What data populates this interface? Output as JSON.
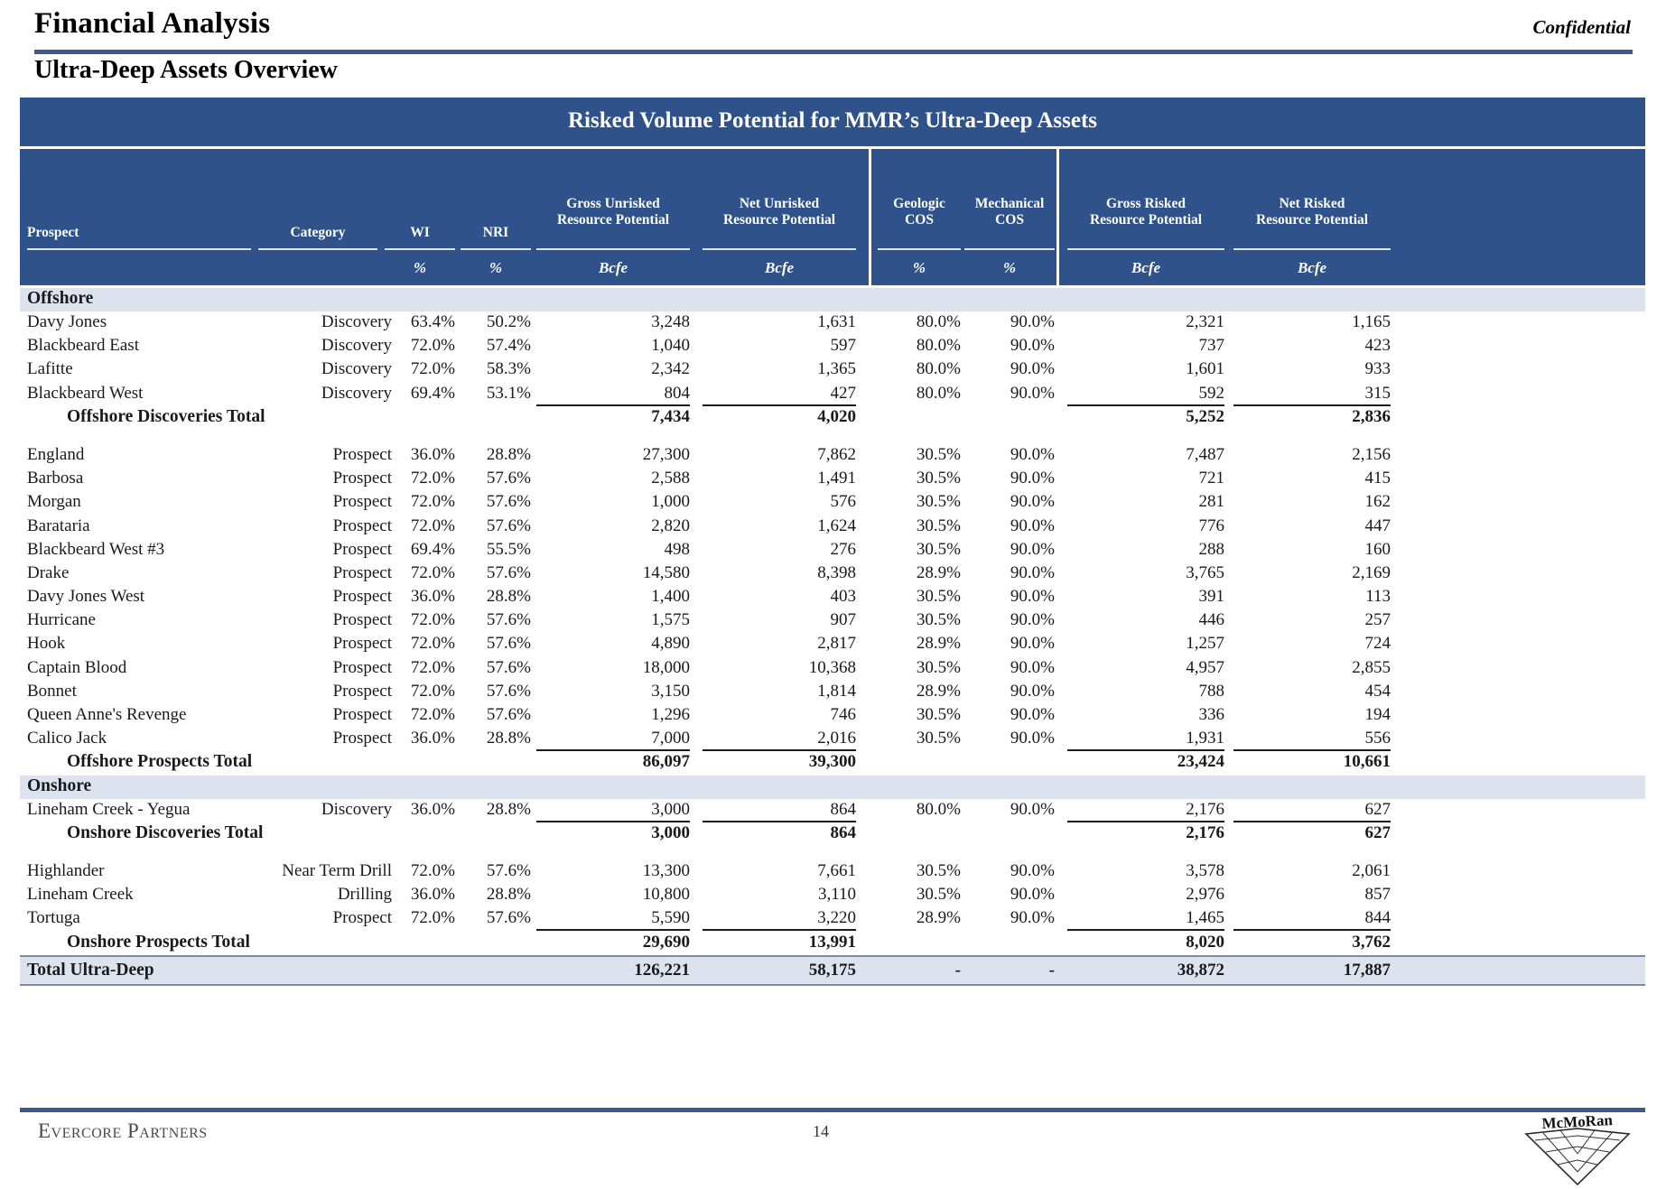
{
  "header": {
    "doc_title": "Financial Analysis",
    "confidential": "Confidential",
    "section_title": "Ultra-Deep Assets Overview"
  },
  "table": {
    "banner": "Risked Volume Potential for MMR’s Ultra-Deep Assets",
    "columns": [
      {
        "l1": "",
        "l2": "Prospect",
        "unit": ""
      },
      {
        "l1": "",
        "l2": "Category",
        "unit": ""
      },
      {
        "l1": "",
        "l2": "WI",
        "unit": "%"
      },
      {
        "l1": "",
        "l2": "NRI",
        "unit": "%"
      },
      {
        "l1": "Gross Unrisked",
        "l2": "Resource Potential",
        "unit": "Bcfe"
      },
      {
        "l1": "Net Unrisked",
        "l2": "Resource Potential",
        "unit": "Bcfe"
      },
      {
        "l1": "Geologic",
        "l2": "COS",
        "unit": "%"
      },
      {
        "l1": "Mechanical",
        "l2": "COS",
        "unit": "%"
      },
      {
        "l1": "Gross Risked",
        "l2": "Resource Potential",
        "unit": "Bcfe"
      },
      {
        "l1": "Net Risked",
        "l2": "Resource Potential",
        "unit": "Bcfe"
      }
    ],
    "groups": [
      {
        "label": "Offshore",
        "blocks": [
          {
            "rows": [
              {
                "prospect": "Davy Jones",
                "category": "Discovery",
                "wi": "63.4%",
                "nri": "50.2%",
                "gross_unrisked": "3,248",
                "net_unrisked": "1,631",
                "geologic_cos": "80.0%",
                "mechanical_cos": "90.0%",
                "gross_risked": "2,321",
                "net_risked": "1,165"
              },
              {
                "prospect": "Blackbeard East",
                "category": "Discovery",
                "wi": "72.0%",
                "nri": "57.4%",
                "gross_unrisked": "1,040",
                "net_unrisked": "597",
                "geologic_cos": "80.0%",
                "mechanical_cos": "90.0%",
                "gross_risked": "737",
                "net_risked": "423"
              },
              {
                "prospect": "Lafitte",
                "category": "Discovery",
                "wi": "72.0%",
                "nri": "58.3%",
                "gross_unrisked": "2,342",
                "net_unrisked": "1,365",
                "geologic_cos": "80.0%",
                "mechanical_cos": "90.0%",
                "gross_risked": "1,601",
                "net_risked": "933"
              },
              {
                "prospect": "Blackbeard West",
                "category": "Discovery",
                "wi": "69.4%",
                "nri": "53.1%",
                "gross_unrisked": "804",
                "net_unrisked": "427",
                "geologic_cos": "80.0%",
                "mechanical_cos": "90.0%",
                "gross_risked": "592",
                "net_risked": "315"
              }
            ],
            "total": {
              "label": "Offshore Discoveries Total",
              "gross_unrisked": "7,434",
              "net_unrisked": "4,020",
              "gross_risked": "5,252",
              "net_risked": "2,836"
            }
          },
          {
            "rows": [
              {
                "prospect": "England",
                "category": "Prospect",
                "wi": "36.0%",
                "nri": "28.8%",
                "gross_unrisked": "27,300",
                "net_unrisked": "7,862",
                "geologic_cos": "30.5%",
                "mechanical_cos": "90.0%",
                "gross_risked": "7,487",
                "net_risked": "2,156"
              },
              {
                "prospect": "Barbosa",
                "category": "Prospect",
                "wi": "72.0%",
                "nri": "57.6%",
                "gross_unrisked": "2,588",
                "net_unrisked": "1,491",
                "geologic_cos": "30.5%",
                "mechanical_cos": "90.0%",
                "gross_risked": "721",
                "net_risked": "415"
              },
              {
                "prospect": "Morgan",
                "category": "Prospect",
                "wi": "72.0%",
                "nri": "57.6%",
                "gross_unrisked": "1,000",
                "net_unrisked": "576",
                "geologic_cos": "30.5%",
                "mechanical_cos": "90.0%",
                "gross_risked": "281",
                "net_risked": "162"
              },
              {
                "prospect": "Barataria",
                "category": "Prospect",
                "wi": "72.0%",
                "nri": "57.6%",
                "gross_unrisked": "2,820",
                "net_unrisked": "1,624",
                "geologic_cos": "30.5%",
                "mechanical_cos": "90.0%",
                "gross_risked": "776",
                "net_risked": "447"
              },
              {
                "prospect": "Blackbeard West #3",
                "category": "Prospect",
                "wi": "69.4%",
                "nri": "55.5%",
                "gross_unrisked": "498",
                "net_unrisked": "276",
                "geologic_cos": "30.5%",
                "mechanical_cos": "90.0%",
                "gross_risked": "288",
                "net_risked": "160"
              },
              {
                "prospect": "Drake",
                "category": "Prospect",
                "wi": "72.0%",
                "nri": "57.6%",
                "gross_unrisked": "14,580",
                "net_unrisked": "8,398",
                "geologic_cos": "28.9%",
                "mechanical_cos": "90.0%",
                "gross_risked": "3,765",
                "net_risked": "2,169"
              },
              {
                "prospect": "Davy Jones West",
                "category": "Prospect",
                "wi": "36.0%",
                "nri": "28.8%",
                "gross_unrisked": "1,400",
                "net_unrisked": "403",
                "geologic_cos": "30.5%",
                "mechanical_cos": "90.0%",
                "gross_risked": "391",
                "net_risked": "113"
              },
              {
                "prospect": "Hurricane",
                "category": "Prospect",
                "wi": "72.0%",
                "nri": "57.6%",
                "gross_unrisked": "1,575",
                "net_unrisked": "907",
                "geologic_cos": "30.5%",
                "mechanical_cos": "90.0%",
                "gross_risked": "446",
                "net_risked": "257"
              },
              {
                "prospect": "Hook",
                "category": "Prospect",
                "wi": "72.0%",
                "nri": "57.6%",
                "gross_unrisked": "4,890",
                "net_unrisked": "2,817",
                "geologic_cos": "28.9%",
                "mechanical_cos": "90.0%",
                "gross_risked": "1,257",
                "net_risked": "724"
              },
              {
                "prospect": "Captain Blood",
                "category": "Prospect",
                "wi": "72.0%",
                "nri": "57.6%",
                "gross_unrisked": "18,000",
                "net_unrisked": "10,368",
                "geologic_cos": "30.5%",
                "mechanical_cos": "90.0%",
                "gross_risked": "4,957",
                "net_risked": "2,855"
              },
              {
                "prospect": "Bonnet",
                "category": "Prospect",
                "wi": "72.0%",
                "nri": "57.6%",
                "gross_unrisked": "3,150",
                "net_unrisked": "1,814",
                "geologic_cos": "28.9%",
                "mechanical_cos": "90.0%",
                "gross_risked": "788",
                "net_risked": "454"
              },
              {
                "prospect": "Queen Anne's Revenge",
                "category": "Prospect",
                "wi": "72.0%",
                "nri": "57.6%",
                "gross_unrisked": "1,296",
                "net_unrisked": "746",
                "geologic_cos": "30.5%",
                "mechanical_cos": "90.0%",
                "gross_risked": "336",
                "net_risked": "194"
              },
              {
                "prospect": "Calico Jack",
                "category": "Prospect",
                "wi": "36.0%",
                "nri": "28.8%",
                "gross_unrisked": "7,000",
                "net_unrisked": "2,016",
                "geologic_cos": "30.5%",
                "mechanical_cos": "90.0%",
                "gross_risked": "1,931",
                "net_risked": "556"
              }
            ],
            "total": {
              "label": "Offshore Prospects Total",
              "gross_unrisked": "86,097",
              "net_unrisked": "39,300",
              "gross_risked": "23,424",
              "net_risked": "10,661"
            }
          }
        ]
      },
      {
        "label": "Onshore",
        "blocks": [
          {
            "rows": [
              {
                "prospect": "Lineham Creek - Yegua",
                "category": "Discovery",
                "wi": "36.0%",
                "nri": "28.8%",
                "gross_unrisked": "3,000",
                "net_unrisked": "864",
                "geologic_cos": "80.0%",
                "mechanical_cos": "90.0%",
                "gross_risked": "2,176",
                "net_risked": "627"
              }
            ],
            "total": {
              "label": "Onshore Discoveries Total",
              "gross_unrisked": "3,000",
              "net_unrisked": "864",
              "gross_risked": "2,176",
              "net_risked": "627"
            }
          },
          {
            "rows": [
              {
                "prospect": "Highlander",
                "category": "Near Term Drill",
                "wi": "72.0%",
                "nri": "57.6%",
                "gross_unrisked": "13,300",
                "net_unrisked": "7,661",
                "geologic_cos": "30.5%",
                "mechanical_cos": "90.0%",
                "gross_risked": "3,578",
                "net_risked": "2,061"
              },
              {
                "prospect": "Lineham Creek",
                "category": "Drilling",
                "wi": "36.0%",
                "nri": "28.8%",
                "gross_unrisked": "10,800",
                "net_unrisked": "3,110",
                "geologic_cos": "30.5%",
                "mechanical_cos": "90.0%",
                "gross_risked": "2,976",
                "net_risked": "857"
              },
              {
                "prospect": "Tortuga",
                "category": "Prospect",
                "wi": "72.0%",
                "nri": "57.6%",
                "gross_unrisked": "5,590",
                "net_unrisked": "3,220",
                "geologic_cos": "28.9%",
                "mechanical_cos": "90.0%",
                "gross_risked": "1,465",
                "net_risked": "844"
              }
            ],
            "total": {
              "label": "Onshore Prospects Total",
              "gross_unrisked": "29,690",
              "net_unrisked": "13,991",
              "gross_risked": "8,020",
              "net_risked": "3,762"
            }
          }
        ]
      }
    ],
    "grand_total": {
      "label": "Total Ultra-Deep",
      "gross_unrisked": "126,221",
      "net_unrisked": "58,175",
      "geologic_cos": "-",
      "mechanical_cos": "-",
      "gross_risked": "38,872",
      "net_risked": "17,887"
    }
  },
  "footer": {
    "advisor": "Evercore Partners",
    "page_number": "14",
    "logo_text": "McMoRan"
  },
  "colors": {
    "header_blue": "#2e5289",
    "rule_blue": "#3c5a8c",
    "group_band": "#dce3ef"
  }
}
